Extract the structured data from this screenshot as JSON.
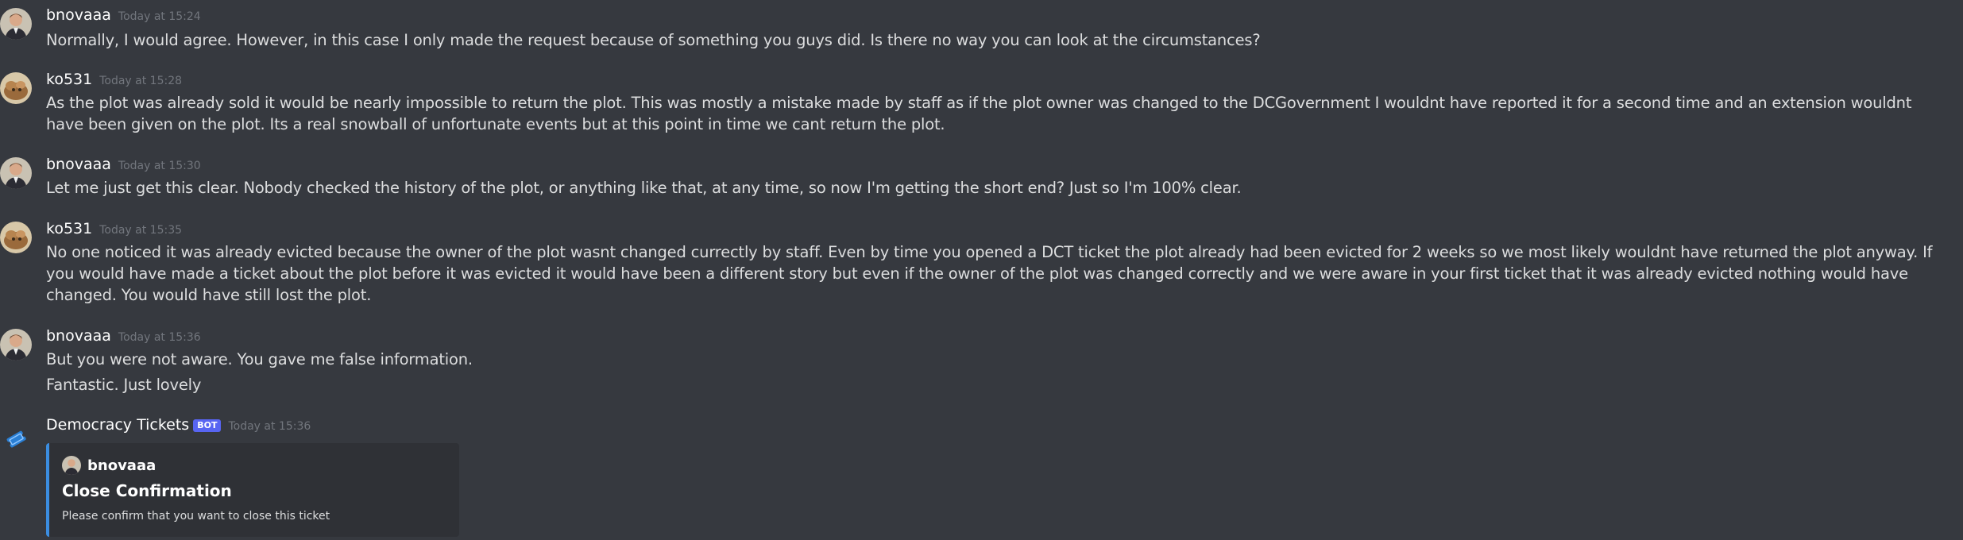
{
  "colors": {
    "background": "#36393f",
    "embed_accent": "#3b8de0",
    "bot_tag": "#5865f2"
  },
  "messages": [
    {
      "author": "bnovaaa",
      "avatar_icon": "bnovaaa-avatar",
      "timestamp": "Today at 15:24",
      "lines": [
        "Normally, I would agree. However, in this case I only made the request because of something you guys did. Is there no way you can look at the circumstances?"
      ]
    },
    {
      "author": "ko531",
      "avatar_icon": "ko531-avatar",
      "timestamp": "Today at 15:28",
      "lines": [
        "As the plot was already sold it would be nearly impossible to return the plot. This was mostly a mistake made by staff as if the plot owner was changed to the DCGovernment I wouldnt have reported it for a second time and an extension wouldnt have been given on the plot. Its a real snowball of unfortunate events but at this point in time we cant return the plot."
      ]
    },
    {
      "author": "bnovaaa",
      "avatar_icon": "bnovaaa-avatar",
      "timestamp": "Today at 15:30",
      "lines": [
        "Let me just get this clear. Nobody checked the history of the plot, or anything like that, at any time, so now I'm getting the short end? Just so I'm 100% clear."
      ]
    },
    {
      "author": "ko531",
      "avatar_icon": "ko531-avatar",
      "timestamp": "Today at 15:35",
      "lines": [
        "No one noticed it was already evicted because the owner of the plot wasnt changed currectly by staff. Even by time you opened a DCT ticket the plot already had been evicted for 2 weeks so we most likely wouldnt have returned the plot anyway. If you would have made a ticket about the plot before it was evicted it would have been a different story but even if the owner of the plot was changed correctly and we were aware in your first ticket that it was already evicted nothing would have changed. You would have still lost the plot."
      ]
    },
    {
      "author": "bnovaaa",
      "avatar_icon": "bnovaaa-avatar",
      "timestamp": "Today at 15:36",
      "lines": [
        "But you were not aware. You gave me false information.",
        "Fantastic. Just lovely"
      ]
    }
  ],
  "bot_message": {
    "author": "Democracy Tickets",
    "bot_tag": "BOT",
    "avatar_icon": "ticket-icon",
    "timestamp": "Today at 15:36",
    "embed": {
      "author_name": "bnovaaa",
      "title": "Close Confirmation",
      "description": "Please confirm that you want to close this ticket"
    }
  }
}
